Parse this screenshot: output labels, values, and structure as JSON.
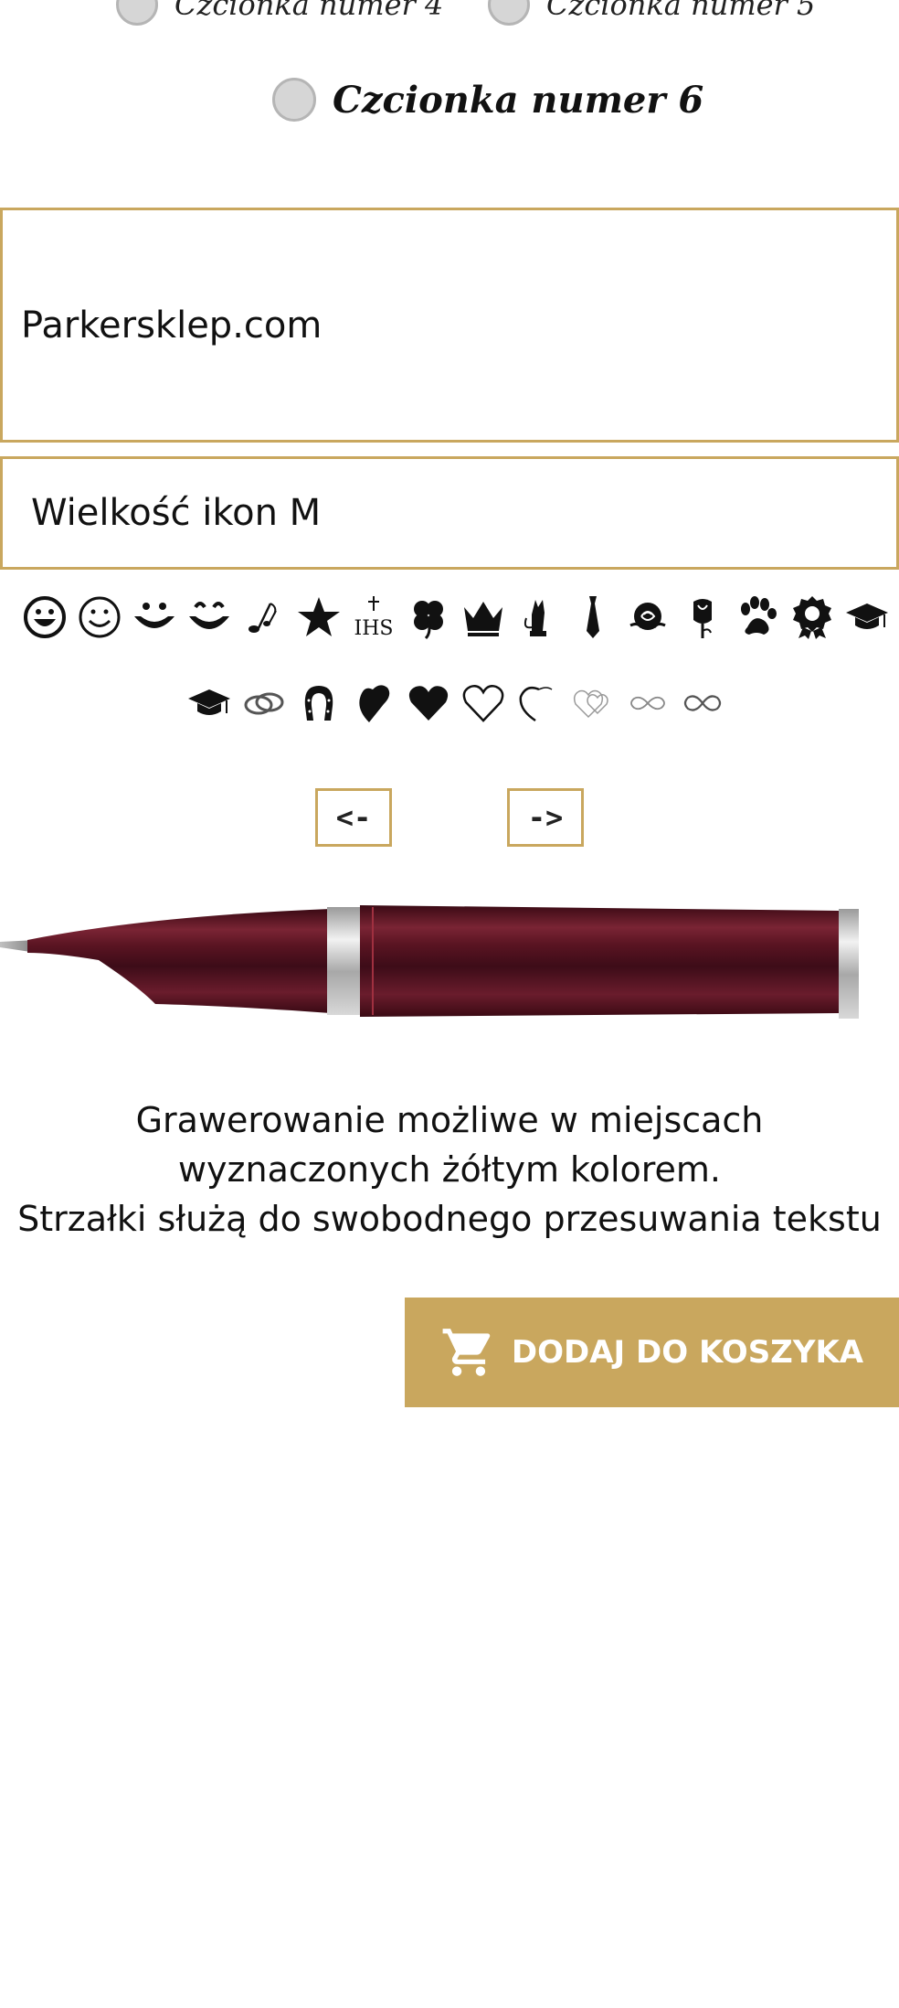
{
  "font_options": [
    {
      "label": "Czcionka numer 4",
      "selected": false
    },
    {
      "label": "Czcionka numer 5",
      "selected": false
    },
    {
      "label": "Czcionka numer 6",
      "selected": false
    }
  ],
  "engraving": {
    "text_value": "Parkersklep.com"
  },
  "icon_size": {
    "label": "Wielkość ikon M"
  },
  "icons": {
    "row1": [
      "grin-smiley-icon",
      "smiley-icon",
      "smile-mouth-icon",
      "happy-mouth-icon",
      "music-notes-icon",
      "star-icon",
      "ihs-cross-icon",
      "four-leaf-clover-icon",
      "crown-icon",
      "cat-icon",
      "tie-icon",
      "rose-icon",
      "rose-bud-icon",
      "paw-icon",
      "rosette-icon",
      "graduation-cap-icon"
    ],
    "row2": [
      "graduation-cap-icon",
      "wedding-rings-icon",
      "horseshoe-icon",
      "leaning-heart-icon",
      "heart-filled-icon",
      "heart-outline-icon",
      "heart-swirl-icon",
      "double-heart-outline-icon",
      "infinity-thin-icon",
      "infinity-icon"
    ],
    "ihs_text": "IHS"
  },
  "arrows": {
    "left_label": "<-",
    "right_label": "->"
  },
  "info_text": {
    "line1": "Grawerowanie możliwe w miejscach",
    "line2": "wyznaczonych żółtym kolorem.",
    "line3": "Strzałki służą do swobodnego przesuwania tekstu"
  },
  "cart": {
    "label": "DODAJ DO KOSZYKA"
  },
  "colors": {
    "accent_gold": "#c9a75e",
    "pen_burgundy": "#5e1424"
  }
}
